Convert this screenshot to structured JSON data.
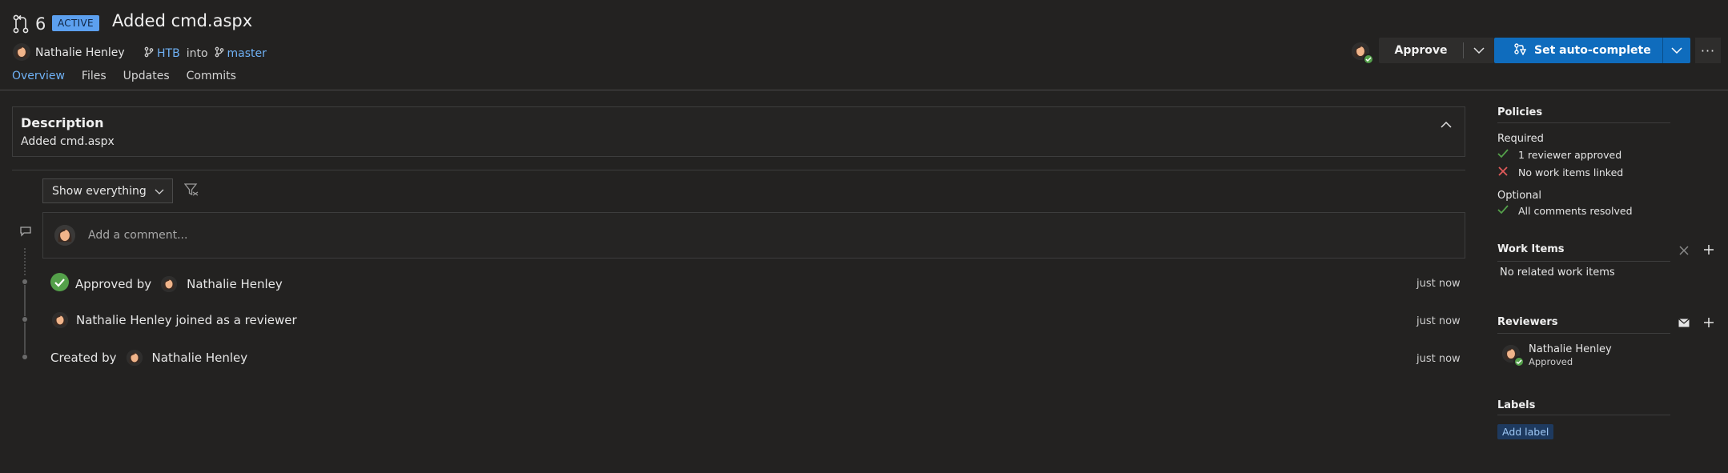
{
  "header": {
    "pr_id": "6",
    "status_badge": "ACTIVE",
    "title": "Added cmd.aspx",
    "author": "Nathalie Henley",
    "source_branch": "HTB",
    "into_text": "into",
    "target_branch": "master"
  },
  "tabs": [
    {
      "label": "Overview",
      "active": true
    },
    {
      "label": "Files"
    },
    {
      "label": "Updates"
    },
    {
      "label": "Commits"
    }
  ],
  "actions": {
    "approve_label": "Approve",
    "autocomplete_label": "Set auto-complete",
    "more_label": "···"
  },
  "description": {
    "heading": "Description",
    "text": "Added cmd.aspx"
  },
  "filter": {
    "selected": "Show everything"
  },
  "comment": {
    "placeholder": "Add a comment..."
  },
  "timeline": [
    {
      "prefix": "Approved by",
      "name": "Nathalie Henley",
      "time": "just now"
    },
    {
      "text": "Nathalie Henley joined as a reviewer",
      "time": "just now"
    },
    {
      "prefix": "Created by",
      "name": "Nathalie Henley",
      "time": "just now"
    }
  ],
  "sidebar": {
    "policies": {
      "heading": "Policies",
      "required_label": "Required",
      "required": [
        {
          "label": "1 reviewer approved",
          "status": "pass"
        },
        {
          "label": "No work items linked",
          "status": "fail"
        }
      ],
      "optional_label": "Optional",
      "optional": [
        {
          "label": "All comments resolved",
          "status": "pass"
        }
      ]
    },
    "work_items": {
      "heading": "Work Items",
      "empty_text": "No related work items"
    },
    "reviewers": {
      "heading": "Reviewers",
      "list": [
        {
          "name": "Nathalie Henley",
          "status": "Approved"
        }
      ]
    },
    "labels": {
      "heading": "Labels",
      "add_label": "Add label"
    }
  },
  "colors": {
    "background": "#232221",
    "accent": "#0f6cbd",
    "link": "#6fb1f5",
    "success": "#54a04a",
    "error": "#e05a5a"
  }
}
